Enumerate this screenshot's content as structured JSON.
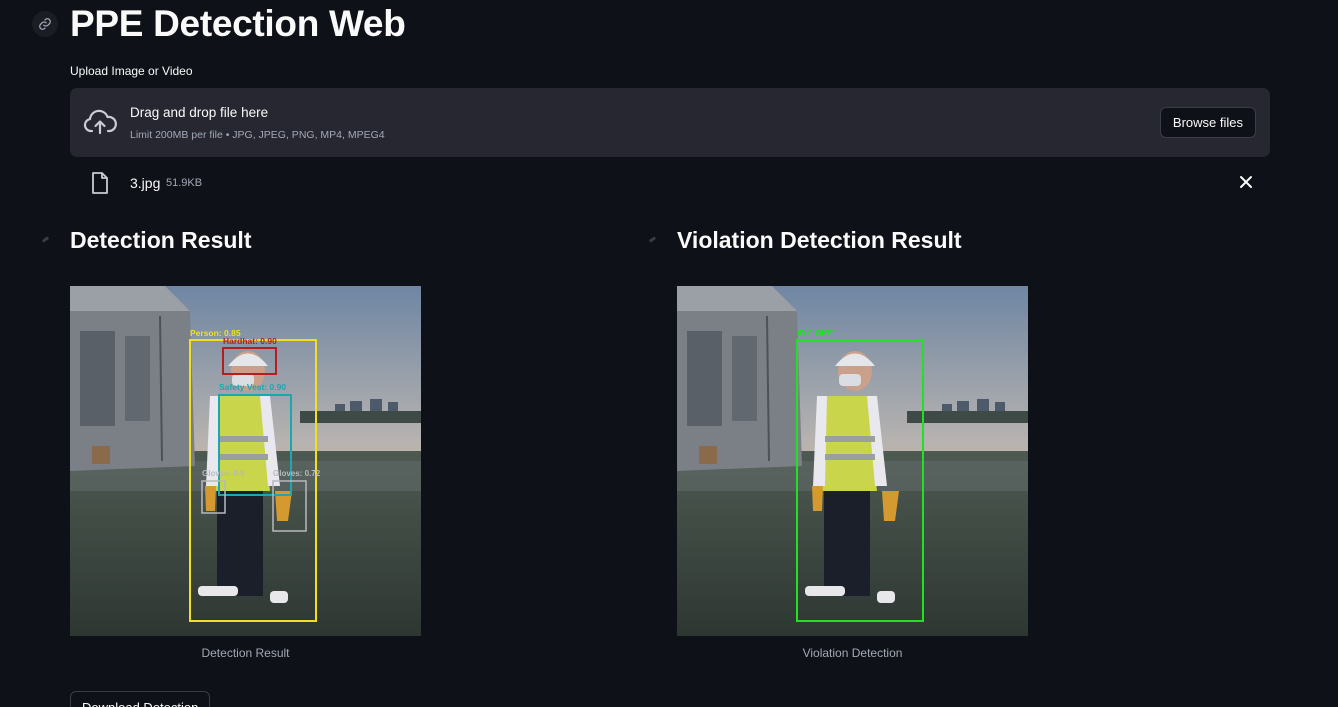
{
  "header": {
    "title": "PPE Detection Web"
  },
  "uploader": {
    "label": "Upload Image or Video",
    "drop_title": "Drag and drop file here",
    "limit_text": "Limit 200MB per file • JPG, JPEG, PNG, MP4, MPEG4",
    "browse_label": "Browse files",
    "upload_icon": "cloud-upload-icon"
  },
  "uploaded_file": {
    "name": "3.jpg",
    "size": "51.9KB",
    "icon": "file-icon",
    "remove_icon": "close-icon"
  },
  "detection": {
    "heading": "Detection Result",
    "caption": "Detection Result",
    "labels": {
      "person": "Person: 0.85",
      "hardhat": "Hardhat: 0.90",
      "vest": "Safety Vest: 0.90",
      "glove_left": "Gloves: 0.6",
      "glove_right": "Gloves: 0.72"
    }
  },
  "violation": {
    "heading": "Violation Detection Result",
    "caption": "Violation Detection",
    "labels": {
      "person": "ID 0 OKE"
    }
  },
  "actions": {
    "download_label": "Download Detection"
  },
  "colors": {
    "background": "#0e1117",
    "surface": "#262730",
    "person_box": "#f0e020",
    "hardhat_box": "#b02020",
    "vest_box": "#1aa8b0",
    "glove_box": "#b8b8c0",
    "ok_box": "#22e022"
  }
}
